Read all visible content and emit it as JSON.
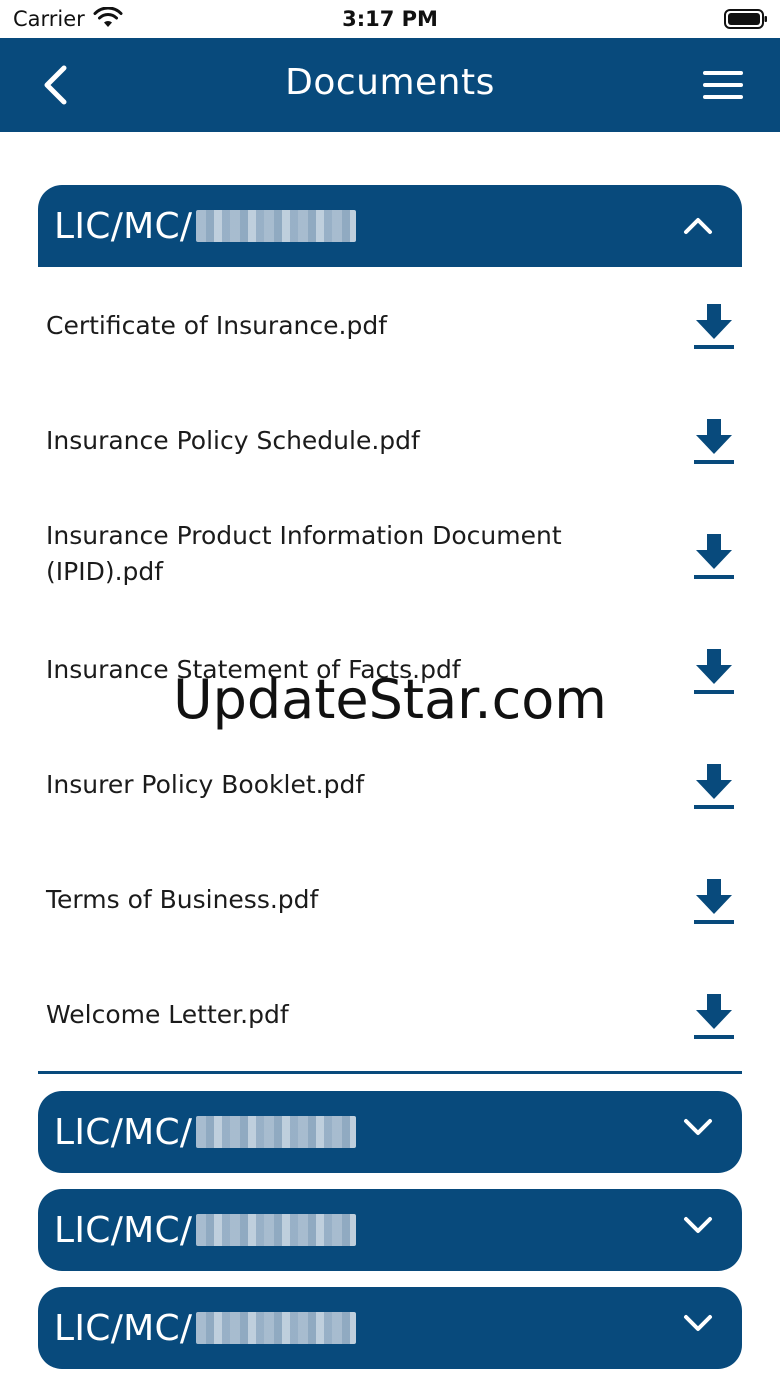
{
  "status_bar": {
    "carrier": "Carrier",
    "time": "3:17 PM"
  },
  "navbar": {
    "title": "Documents",
    "back_icon": "chevron-left-icon",
    "menu_icon": "hamburger-menu-icon"
  },
  "accordions": [
    {
      "label": "LIC/MC/",
      "expanded": true
    },
    {
      "label": "LIC/MC/",
      "expanded": false
    },
    {
      "label": "LIC/MC/",
      "expanded": false
    },
    {
      "label": "LIC/MC/",
      "expanded": false
    }
  ],
  "documents": [
    {
      "name": "Certificate of Insurance.pdf"
    },
    {
      "name": "Insurance Policy Schedule.pdf"
    },
    {
      "name": "Insurance Product Information Document (IPID).pdf"
    },
    {
      "name": "Insurance Statement of Facts.pdf"
    },
    {
      "name": "Insurer Policy Booklet.pdf"
    },
    {
      "name": "Terms of Business.pdf"
    },
    {
      "name": "Welcome Letter.pdf"
    }
  ],
  "watermark": "UpdateStar.com",
  "colors": {
    "primary": "#084a7c",
    "text": "#1b1b1b",
    "background": "#ffffff"
  }
}
